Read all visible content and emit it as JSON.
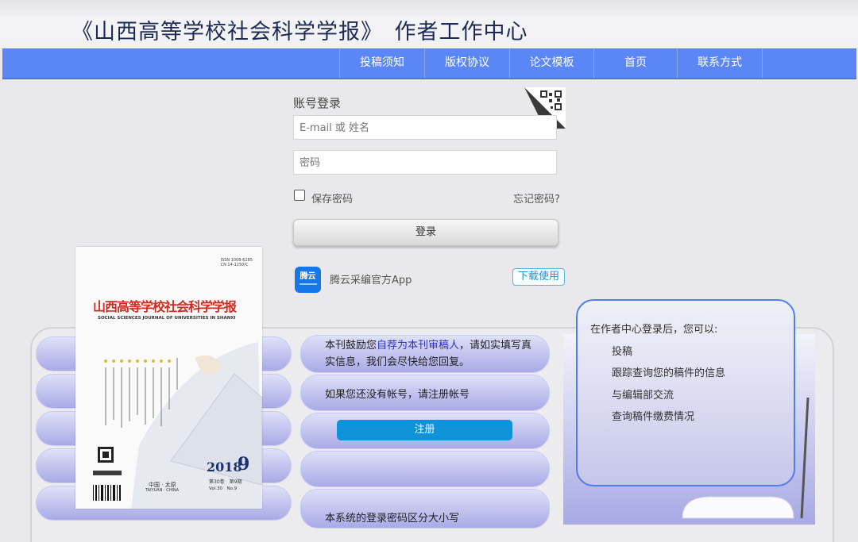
{
  "header": {
    "title": "《山西高等学校社会科学学报》　作者工作中心"
  },
  "nav": {
    "items": [
      {
        "label": "投稿须知"
      },
      {
        "label": "版权协议"
      },
      {
        "label": "论文模板"
      },
      {
        "label": "首页"
      },
      {
        "label": "联系方式"
      }
    ]
  },
  "login": {
    "title": "账号登录",
    "username_placeholder": "E-mail 或 姓名",
    "password_placeholder": "密码",
    "remember_label": "保存密码",
    "remember_checked": false,
    "forgot_label": "忘记密码?",
    "login_button": "登录"
  },
  "app": {
    "icon_text": "腾云",
    "name": "腾云采编官方App",
    "download_button": "下载使用"
  },
  "cover": {
    "journal_title": "山西高等学校社会科学学报",
    "journal_title_en": "SOCIAL SCIENCES JOURNAL OF UNIVERSITIES IN SHANXI",
    "issn": "ISSN 1008-6285",
    "cn": "CN 14-1250/C",
    "year": "2018",
    "issue": "9",
    "place": "中国 · 太原",
    "place_en": "TAIYUAN · CHINA",
    "volume_cn": "第30卷　第9期",
    "volume_en": "Vol.30　No.9"
  },
  "registration": {
    "encourage_prefix": "本刊鼓励您",
    "encourage_link": "自荐为本刊审稿人",
    "encourage_suffix": "，请如实填写真实信息，我们会尽快给您回复。",
    "no_account_text": "如果您还没有帐号，请注册帐号",
    "register_button": "注册",
    "case_note": "本系统的登录密码区分大小写"
  },
  "info": {
    "title": "在作者中心登录后，您可以:",
    "items": [
      "投稿",
      "跟踪查询您的稿件的信息",
      "与编辑部交流",
      "查询稿件缴费情况"
    ]
  },
  "colors": {
    "nav_bg": "#5b86f5",
    "register_bg": "#0e93d8",
    "info_border": "#4f7fe6",
    "title_color": "#1e2a55",
    "cover_title_red": "#d02b1e"
  }
}
